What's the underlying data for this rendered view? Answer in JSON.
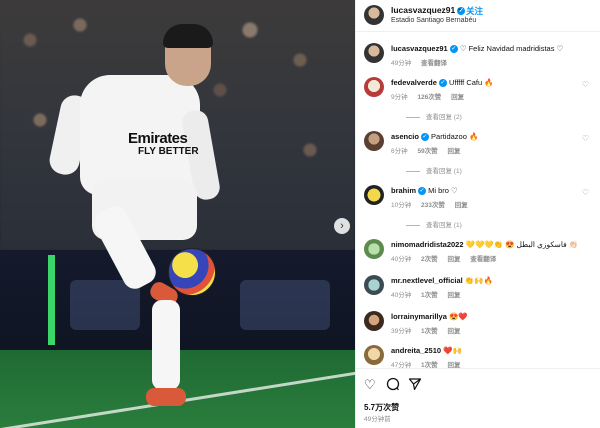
{
  "post": {
    "username": "lucasvazquez91",
    "follow_label": "关注",
    "location": "Estadio Santiago Bernabéu",
    "jersey_sponsor_line1": "Emirates",
    "jersey_sponsor_line2": "FLY BETTER"
  },
  "comments": [
    {
      "user": "lucasvazquez91",
      "text": "♡ Feliz Navidad madridistas ♡",
      "time": "49分钟",
      "likes": "",
      "reply": "查看翻译",
      "verified": true
    },
    {
      "user": "fedevalverde",
      "text": "Ufffff Cafu 🔥",
      "time": "9分钟",
      "likes": "126次赞",
      "reply": "回复",
      "verified": true,
      "replies": "查看回复 (2)"
    },
    {
      "user": "asencio",
      "text": "Partidazoo 🔥",
      "time": "6分钟",
      "likes": "59次赞",
      "reply": "回复",
      "verified": true,
      "replies": "查看回复 (1)"
    },
    {
      "user": "brahim",
      "text": "Mi bro ♡",
      "time": "10分钟",
      "likes": "233次赞",
      "reply": "回复",
      "verified": true,
      "replies": "查看回复 (1)"
    },
    {
      "user": "nimomadridista2022",
      "text": "💛💛💛👏 😍 فاسكوزي البطل 👏🏻",
      "time": "40分钟",
      "likes": "2次赞",
      "reply": "回复",
      "translate": "查看翻译",
      "verified": false
    },
    {
      "user": "mr.nextlevel_official",
      "text": "👏🙌🔥",
      "time": "40分钟",
      "likes": "1次赞",
      "reply": "回复",
      "verified": false
    },
    {
      "user": "lorrainymarillya",
      "text": "😍❤️",
      "time": "39分钟",
      "likes": "1次赞",
      "reply": "回复",
      "verified": false
    },
    {
      "user": "andreita_2510",
      "text": "❤️🙌",
      "time": "47分钟",
      "likes": "1次赞",
      "reply": "回复",
      "verified": false
    }
  ],
  "footer": {
    "like_icon": "heart-outline",
    "comment_icon": "speech-bubble",
    "share_icon": "paper-plane",
    "likes": "5.7万次赞",
    "time": "49分钟前"
  },
  "colors": {
    "accent": "#0095f6",
    "muted": "#8e8e8e"
  }
}
